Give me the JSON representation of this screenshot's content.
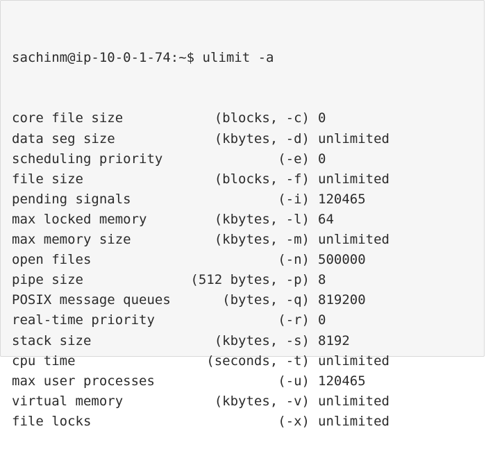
{
  "terminal": {
    "prompt": "sachinm@ip-10-0-1-74:~$ ulimit -a",
    "rows": [
      {
        "name": "core file size",
        "unit": "(blocks, -c)",
        "value": "0"
      },
      {
        "name": "data seg size",
        "unit": "(kbytes, -d)",
        "value": "unlimited"
      },
      {
        "name": "scheduling priority",
        "unit": "(-e)",
        "value": "0"
      },
      {
        "name": "file size",
        "unit": "(blocks, -f)",
        "value": "unlimited"
      },
      {
        "name": "pending signals",
        "unit": "(-i)",
        "value": "120465"
      },
      {
        "name": "max locked memory",
        "unit": "(kbytes, -l)",
        "value": "64"
      },
      {
        "name": "max memory size",
        "unit": "(kbytes, -m)",
        "value": "unlimited"
      },
      {
        "name": "open files",
        "unit": "(-n)",
        "value": "500000"
      },
      {
        "name": "pipe size",
        "unit": "(512 bytes, -p)",
        "value": "8"
      },
      {
        "name": "POSIX message queues",
        "unit": "(bytes, -q)",
        "value": "819200"
      },
      {
        "name": "real-time priority",
        "unit": "(-r)",
        "value": "0"
      },
      {
        "name": "stack size",
        "unit": "(kbytes, -s)",
        "value": "8192"
      },
      {
        "name": "cpu time",
        "unit": "(seconds, -t)",
        "value": "unlimited"
      },
      {
        "name": "max user processes",
        "unit": "(-u)",
        "value": "120465"
      },
      {
        "name": "virtual memory",
        "unit": "(kbytes, -v)",
        "value": "unlimited"
      },
      {
        "name": "file locks",
        "unit": "(-x)",
        "value": "unlimited"
      }
    ]
  }
}
